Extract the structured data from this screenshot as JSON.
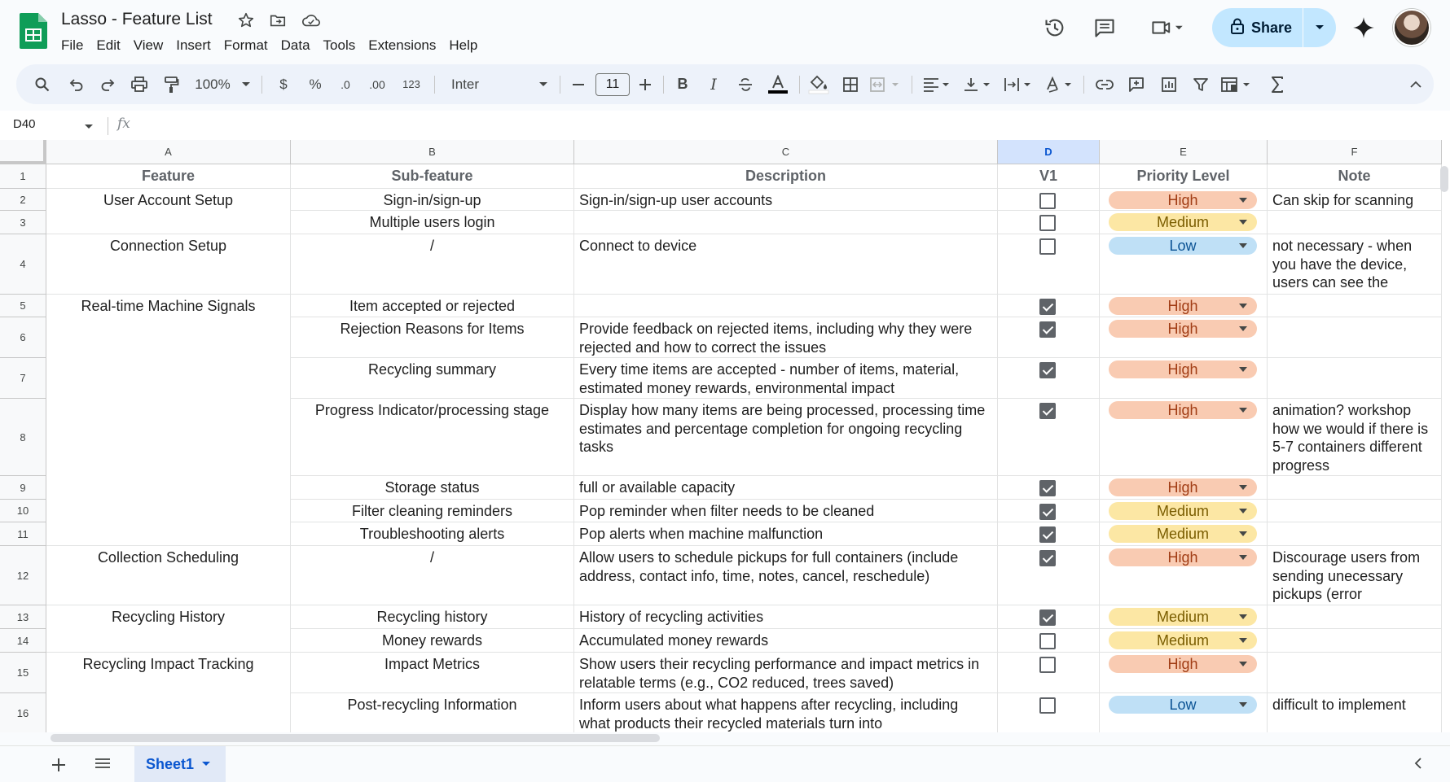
{
  "header": {
    "doc_title": "Lasso - Feature List",
    "menu": [
      "File",
      "Edit",
      "View",
      "Insert",
      "Format",
      "Data",
      "Tools",
      "Extensions",
      "Help"
    ],
    "share_label": "Share"
  },
  "toolbar": {
    "zoom": "100%",
    "currency": "$",
    "percent": "%",
    "dec_decrease": ".0",
    "dec_increase": ".00",
    "number_format": "123",
    "font": "Inter",
    "font_size": "11",
    "bold": "B",
    "italic": "I"
  },
  "formula_bar": {
    "name_box": "D40",
    "fx": "fx"
  },
  "columns": [
    "A",
    "B",
    "C",
    "D",
    "E",
    "F"
  ],
  "selected_column": "D",
  "rows": [
    "1",
    "2",
    "3",
    "4",
    "5",
    "6",
    "7",
    "8",
    "9",
    "10",
    "11",
    "12",
    "13",
    "14",
    "15",
    "16"
  ],
  "table": {
    "headers": [
      "Feature",
      "Sub-feature",
      "Description",
      "V1",
      "Priority Level",
      "Note"
    ],
    "cells": {
      "a2": "User Account Setup",
      "a4": "Connection Setup",
      "a5": "Real-time Machine Signals",
      "a12": "Collection Scheduling",
      "a13": "Recycling History",
      "a15": "Recycling Impact Tracking",
      "b2": "Sign-in/sign-up",
      "b3": "Multiple users login",
      "b4": "/",
      "b5": "Item accepted or rejected",
      "b6": "Rejection Reasons for Items",
      "b7": "Recycling summary",
      "b8": "Progress Indicator/processing stage",
      "b9": "Storage status",
      "b10": "Filter cleaning reminders",
      "b11": "Troubleshooting alerts",
      "b12": "/",
      "b13": "Recycling history",
      "b14": "Money rewards",
      "b15": "Impact Metrics",
      "b16": "Post-recycling Information",
      "c2": "Sign-in/sign-up user accounts",
      "c4": "Connect to device",
      "c6": "Provide feedback on rejected items, including why they were rejected and how to correct the issues",
      "c7": "Every time items are accepted - number of items, material, estimated money rewards, environmental impact",
      "c8": "Display how many items are being processed, processing time estimates and percentage completion for ongoing recycling tasks",
      "c9": "full or available capacity",
      "c10": "Pop reminder when filter needs to be cleaned",
      "c11": "Pop alerts when machine malfunction",
      "c12": "Allow users to schedule pickups for full containers (include address, contact info, time, notes, cancel, reschedule)",
      "c13": "History of recycling activities",
      "c14": "Accumulated money rewards",
      "c15": "Show users their recycling performance and impact metrics in relatable terms (e.g., CO2 reduced, trees saved)",
      "c16": "Inform users about what happens after recycling, including what products their recycled materials turn into",
      "f2": "Can skip for scanning",
      "f4": "not necessary - when you have the device, users can see the scanning feature",
      "f8": "animation? workshop how we would if there is 5-7 containers different progress",
      "f12": "Discourage users from sending unecessary pickups (error prevention?)",
      "f16": "difficult to implement"
    },
    "v1": [
      false,
      false,
      false,
      true,
      true,
      true,
      true,
      true,
      true,
      true,
      true,
      true,
      false,
      false,
      false
    ],
    "priority": [
      "High",
      "Medium",
      "Low",
      "High",
      "High",
      "High",
      "High",
      "High",
      "Medium",
      "Medium",
      "High",
      "Medium",
      "Medium",
      "High",
      "Low"
    ]
  },
  "sheets": [
    "Sheet1"
  ],
  "colors": {
    "high_bg": "#f9cbb2",
    "medium_bg": "#fce7a4",
    "low_bg": "#bfe0f6",
    "share_bg": "#c2e7ff",
    "sheets_green": "#0f9d58"
  }
}
